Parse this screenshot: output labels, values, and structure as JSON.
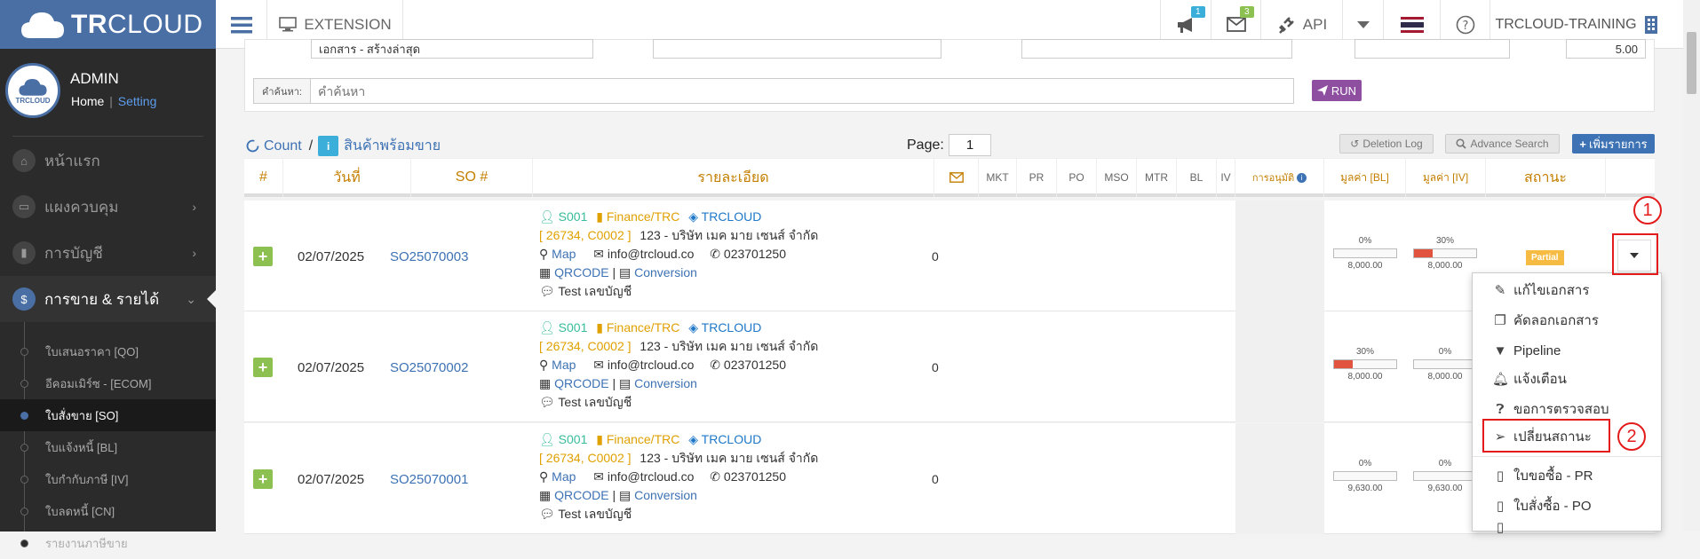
{
  "brand": {
    "name_bold": "TR",
    "name_rest": "CLOUD",
    "color": "#4a6fa5"
  },
  "topbar": {
    "extension_label": "EXTENSION",
    "notif_count": "1",
    "mail_count": "3",
    "api_label": "API",
    "company": "TRCLOUD-TRAINING"
  },
  "user": {
    "name": "ADMIN",
    "home": "Home",
    "separator": "|",
    "setting": "Setting",
    "avatar_text": "TRCLOUD"
  },
  "sidebar": {
    "items": [
      {
        "label": "หน้าแรก",
        "icon": "home-icon"
      },
      {
        "label": "แผงควบคุม",
        "icon": "monitor-icon"
      },
      {
        "label": "การบัญชี",
        "icon": "book-icon"
      },
      {
        "label": "การขาย & รายได้",
        "icon": "dollar-icon"
      }
    ],
    "sub": [
      {
        "label": "ใบเสนอราคา [QO]"
      },
      {
        "label": "อีคอมเมิร์ซ - [ECOM]"
      },
      {
        "label": "ใบสั่งขาย [SO]"
      },
      {
        "label": "ใบแจ้งหนี้ [BL]"
      },
      {
        "label": "ใบกำกับภาษี [IV]"
      },
      {
        "label": "ใบลดหนี้ [CN]"
      },
      {
        "label": "รายงานภาษีขาย"
      }
    ]
  },
  "filters": {
    "doc_type_value": "เอกสาร - สร้างล่าสุด",
    "amount_value": "5.00",
    "search_label": "คำค้นหา:",
    "search_placeholder": "คำค้นหา",
    "run_label": "RUN"
  },
  "toolbar": {
    "count_label": "Count",
    "slash": "/",
    "info_label": "สินค้าพร้อมขาย",
    "page_label": "Page:",
    "page_value": "1",
    "deletion_log": "Deletion Log",
    "advance_search": "Advance Search",
    "add_label": "เพิ่มรายการ"
  },
  "table": {
    "headers": {
      "num": "#",
      "date": "วันที่",
      "so": "SO #",
      "detail": "รายละเอียด",
      "mkt": "MKT",
      "pr": "PR",
      "po": "PO",
      "mso": "MSO",
      "mtr": "MTR",
      "bl": "BL",
      "iv": "IV",
      "approve": "การอนุมัติ",
      "val_bl": "มูลค่า [BL]",
      "val_iv": "มูลค่า [IV]",
      "status": "สถานะ"
    },
    "rows": [
      {
        "date": "02/07/2025",
        "so": "SO25070003",
        "user": "S001",
        "dept": "Finance/TRC",
        "project": "TRCLOUD",
        "code": "[ 26734, C0002 ]",
        "customer": "123 - บริษัท เมค มาย เซนส์ จำกัด",
        "map": "Map",
        "email": "info@trcloud.co",
        "phone": "023701250",
        "qr": "QRCODE",
        "bar": "|",
        "conv": "Conversion",
        "note": "Test เลขบัญชี",
        "mail_count": "0",
        "bl_pct": "0%",
        "bl_fill": 0,
        "bl_val": "8,000.00",
        "iv_pct": "30%",
        "iv_fill": 30,
        "iv_val": "8,000.00",
        "status": "Partial"
      },
      {
        "date": "02/07/2025",
        "so": "SO25070002",
        "user": "S001",
        "dept": "Finance/TRC",
        "project": "TRCLOUD",
        "code": "[ 26734, C0002 ]",
        "customer": "123 - บริษัท เมค มาย เซนส์ จำกัด",
        "map": "Map",
        "email": "info@trcloud.co",
        "phone": "023701250",
        "qr": "QRCODE",
        "bar": "|",
        "conv": "Conversion",
        "note": "Test เลขบัญชี",
        "mail_count": "0",
        "bl_pct": "30%",
        "bl_fill": 30,
        "bl_val": "8,000.00",
        "iv_pct": "0%",
        "iv_fill": 0,
        "iv_val": "8,000.00",
        "status": ""
      },
      {
        "date": "02/07/2025",
        "so": "SO25070001",
        "user": "S001",
        "dept": "Finance/TRC",
        "project": "TRCLOUD",
        "code": "[ 26734, C0002 ]",
        "customer": "123 - บริษัท เมค มาย เซนส์ จำกัด",
        "map": "Map",
        "email": "info@trcloud.co",
        "phone": "023701250",
        "qr": "QRCODE",
        "bar": "|",
        "conv": "Conversion",
        "note": "Test เลขบัญชี",
        "mail_count": "0",
        "bl_pct": "0%",
        "bl_fill": 0,
        "bl_val": "9,630.00",
        "iv_pct": "0%",
        "iv_fill": 0,
        "iv_val": "9,630.00",
        "status": ""
      }
    ]
  },
  "dropdown": {
    "items": [
      {
        "label": "แก้ไขเอกสาร",
        "icon": "edit-icon"
      },
      {
        "label": "คัดลอกเอกสาร",
        "icon": "copy-icon"
      },
      {
        "label": "Pipeline",
        "icon": "filter-icon"
      },
      {
        "label": "แจ้งเตือน",
        "icon": "bell-icon"
      },
      {
        "label": "ขอการตรวจสอบ",
        "icon": "question-icon"
      },
      {
        "label": "เปลี่ยนสถานะ",
        "icon": "send-icon"
      },
      {
        "label": "ใบขอซื้อ - PR",
        "icon": "file-icon"
      },
      {
        "label": "ใบสั่งซื้อ - PO",
        "icon": "file-icon"
      }
    ]
  },
  "annotations": {
    "one": "1",
    "two": "2"
  },
  "colors": {
    "accent": "#4a6fa5",
    "green": "#8cc152",
    "orange": "#e0a100",
    "red": "#e31b1b",
    "partial": "#f6bb42",
    "purple": "#8e4fa1"
  }
}
